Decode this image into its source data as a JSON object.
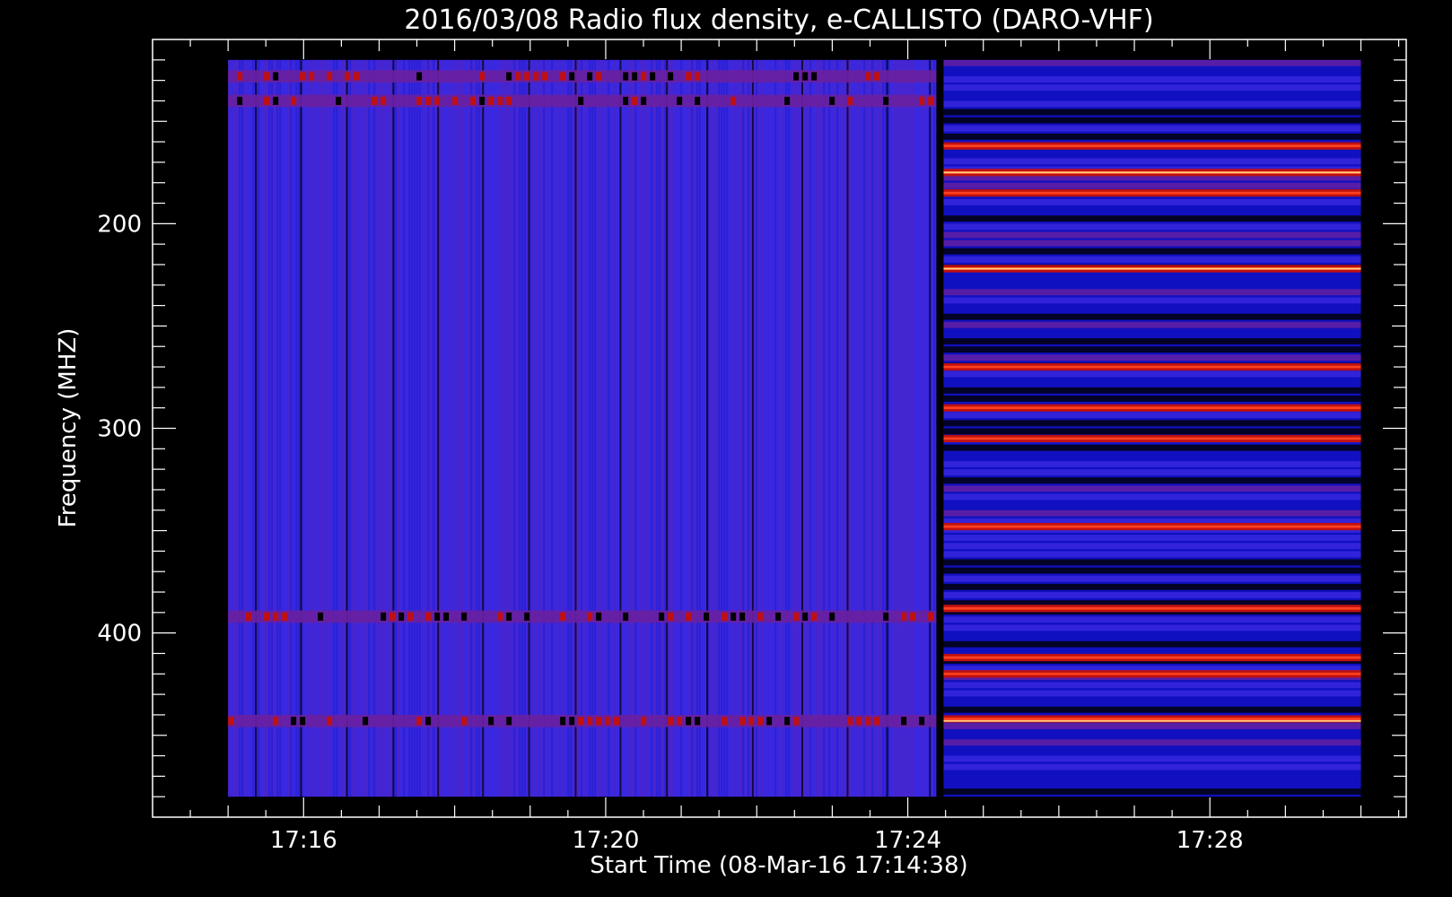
{
  "chart_data": {
    "type": "heatmap",
    "title": "2016/03/08  Radio flux density, e-CALLISTO (DARO-VHF)",
    "xlabel": "Start Time (08-Mar-16 17:14:38)",
    "ylabel": "Frequency (MHZ)",
    "x_range_minutes": [
      "17:14:38",
      "17:30:38"
    ],
    "xlim_minutes_since_17h": [
      14.0,
      30.6
    ],
    "ylim": [
      110,
      490
    ],
    "y_inverted": true,
    "data_extent": {
      "time_start": "17:15:00",
      "time_end": "17:30:00",
      "freq_min": 120,
      "freq_max": 480
    },
    "x_ticks": [
      {
        "label": "17:16",
        "minute": 16
      },
      {
        "label": "17:20",
        "minute": 20
      },
      {
        "label": "17:24",
        "minute": 24
      },
      {
        "label": "17:28",
        "minute": 28
      }
    ],
    "y_ticks": [
      {
        "label": "200",
        "value": 200
      },
      {
        "label": "300",
        "value": 300
      },
      {
        "label": "400",
        "value": 400
      }
    ],
    "regime_change_minute": 24.45,
    "colormap": [
      "#000000",
      "#1010c0",
      "#3a28e0",
      "#6a20a0",
      "#c01010",
      "#ff4020",
      "#ffd080"
    ],
    "bright_bands_after_change_mhz": [
      162,
      175,
      185,
      222,
      270,
      290,
      305,
      348,
      388,
      412,
      420,
      442
    ],
    "bright_bands_before_change_mhz": [
      128,
      140,
      392,
      443
    ]
  }
}
